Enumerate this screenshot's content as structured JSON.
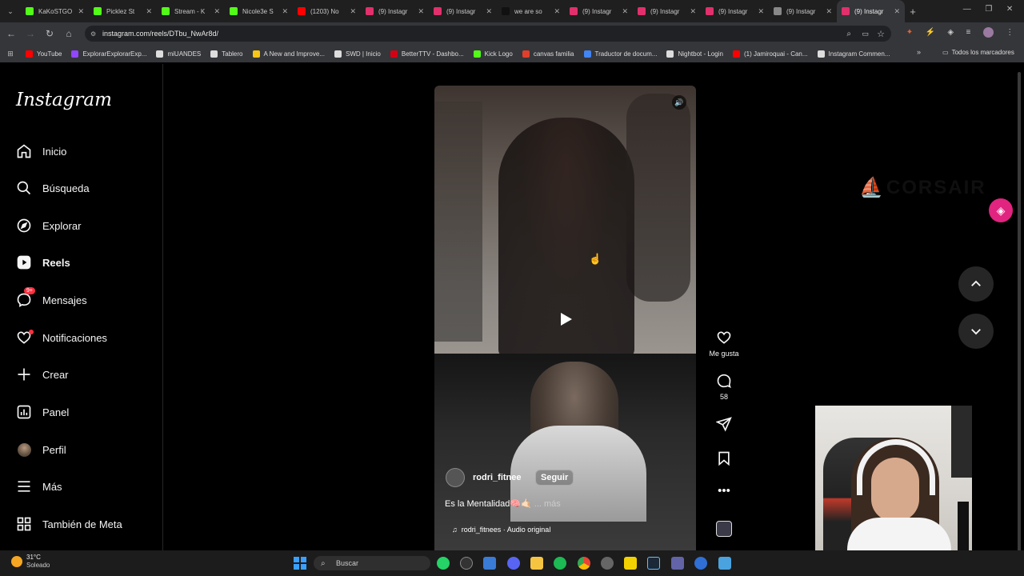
{
  "browser": {
    "tabs": [
      {
        "title": "KaKoSTGO",
        "color": "#53fc18"
      },
      {
        "title": "Picklez St",
        "color": "#53fc18"
      },
      {
        "title": "Stream - K",
        "color": "#53fc18"
      },
      {
        "title": "Nicole3e S",
        "color": "#53fc18"
      },
      {
        "title": "(1203) No",
        "color": "#ff0000"
      },
      {
        "title": "(9) Instagr",
        "color": "#e1306c"
      },
      {
        "title": "(9) Instagr",
        "color": "#e1306c"
      },
      {
        "title": "we are so",
        "color": "#111111"
      },
      {
        "title": "(9) Instagr",
        "color": "#e1306c"
      },
      {
        "title": "(9) Instagr",
        "color": "#e1306c"
      },
      {
        "title": "(9) Instagr",
        "color": "#e1306c"
      },
      {
        "title": "(9) Instagr",
        "color": "#888888"
      },
      {
        "title": "(9) Instagr",
        "color": "#e1306c"
      }
    ],
    "url": "instagram.com/reels/DTbu_NwAr8d/",
    "bookmarks": [
      {
        "label": "YouTube",
        "color": "#ff0000"
      },
      {
        "label": "ExplorarExplorarExp...",
        "color": "#9146ff"
      },
      {
        "label": "miUANDES",
        "color": "#dddddd"
      },
      {
        "label": "Tablero",
        "color": "#dddddd"
      },
      {
        "label": "A New and Improve...",
        "color": "#f5c518"
      },
      {
        "label": "SWD | Inicio",
        "color": "#dddddd"
      },
      {
        "label": "BetterTTV - Dashbo...",
        "color": "#d50014"
      },
      {
        "label": "Kick Logo",
        "color": "#53fc18"
      },
      {
        "label": "canvas familia",
        "color": "#e13f2b"
      },
      {
        "label": "Traductor de docum...",
        "color": "#4285f4"
      },
      {
        "label": "Nightbot - Login",
        "color": "#dddddd"
      },
      {
        "label": "(1) Jamiroquai - Can...",
        "color": "#ff0000"
      },
      {
        "label": "Instagram Commen...",
        "color": "#dddddd"
      }
    ],
    "bookmarks_folder": "Todos los marcadores"
  },
  "sidebar": {
    "logo": "Instagram",
    "items": [
      {
        "label": "Inicio",
        "icon": "home-icon"
      },
      {
        "label": "Búsqueda",
        "icon": "search-icon"
      },
      {
        "label": "Explorar",
        "icon": "compass-icon"
      },
      {
        "label": "Reels",
        "icon": "reels-icon"
      },
      {
        "label": "Mensajes",
        "icon": "messenger-icon"
      },
      {
        "label": "Notificaciones",
        "icon": "heart-icon"
      },
      {
        "label": "Crear",
        "icon": "plus-icon"
      },
      {
        "label": "Panel",
        "icon": "dashboard-icon"
      },
      {
        "label": "Perfil",
        "icon": "avatar-icon"
      },
      {
        "label": "Más",
        "icon": "menu-icon"
      },
      {
        "label": "También de Meta",
        "icon": "grid-icon"
      }
    ],
    "messages_badge": "9+"
  },
  "reel": {
    "username": "rodri_fitnee",
    "follow_label": "Seguir",
    "caption": "Es la Mentalidad🧠🤙🏻",
    "more_label": "... más",
    "audio": "rodri_fitnees · Audio original",
    "likes_label": "Me gusta",
    "comments_count": "58"
  },
  "overlay": {
    "brand": "CORSAIR"
  },
  "taskbar": {
    "weather_temp": "31°C",
    "weather_desc": "Soleado",
    "search_label": "Buscar"
  }
}
